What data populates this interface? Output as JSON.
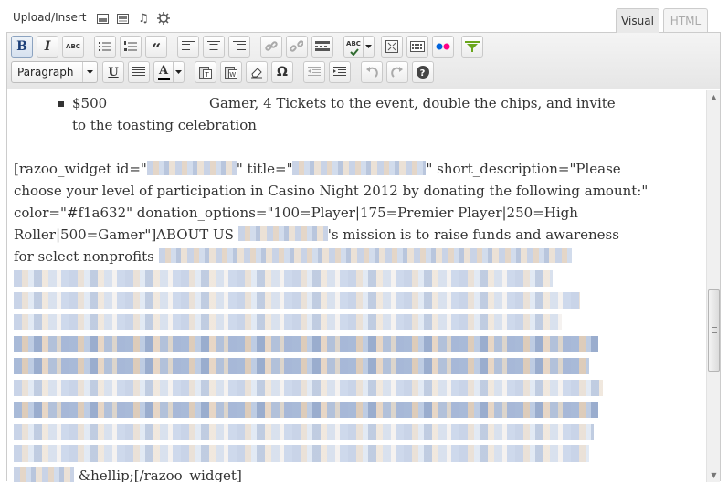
{
  "media": {
    "upload_label": "Upload/Insert",
    "icons": [
      "image-icon",
      "video-icon",
      "audio-icon",
      "media-icon"
    ]
  },
  "tabs": {
    "visual": "Visual",
    "html": "HTML",
    "active": "Visual"
  },
  "toolbar": {
    "row1": [
      "bold",
      "italic",
      "strikethrough",
      "bulleted-list",
      "numbered-list",
      "blockquote",
      "align-left",
      "align-center",
      "align-right",
      "insert-link",
      "unlink",
      "insert-more",
      "spellcheck",
      "fullscreen",
      "kitchen-sink",
      "flickr",
      "tag"
    ],
    "row2": [
      "format",
      "underline",
      "justify",
      "text-color",
      "paste-text",
      "paste-word",
      "clear-formatting",
      "special-character",
      "outdent",
      "indent",
      "undo",
      "redo",
      "help"
    ],
    "bold_label": "B",
    "italic_label": "I",
    "strike_label": "ABC",
    "spell_label": "ABC",
    "underline_label": "U",
    "textcolor_label": "A",
    "omega_label": "Ω",
    "format_value": "Paragraph",
    "colors": {
      "flickr_blue": "#0063dc",
      "flickr_pink": "#ff0084",
      "tag_green": "#6aa61c",
      "text_color_bar": "#000000"
    }
  },
  "content": {
    "list_item": {
      "amount": "$500",
      "rest": "Gamer, 4 Tickets to the event, double the chips, and invite",
      "continuation": "to the toasting celebration"
    },
    "shortcode_lines": [
      {
        "pre": "[razoo_widget id=\"",
        "mid": "\" title=\"",
        "post": "\" short_description=\"Please"
      },
      {
        "text": "choose your level of participation in Casino Night 2012 by donating the following amount:\""
      },
      {
        "text": "color=\"#f1a632\" donation_options=\"100=Player|175=Premier Player|250=High"
      },
      {
        "pre": "Roller|500=Gamer\"]ABOUT US",
        "post": "'s mission is to raise funds and awareness"
      },
      {
        "text": "for select nonprofits"
      }
    ],
    "closing": "&hellip;[/razoo_widget]"
  }
}
